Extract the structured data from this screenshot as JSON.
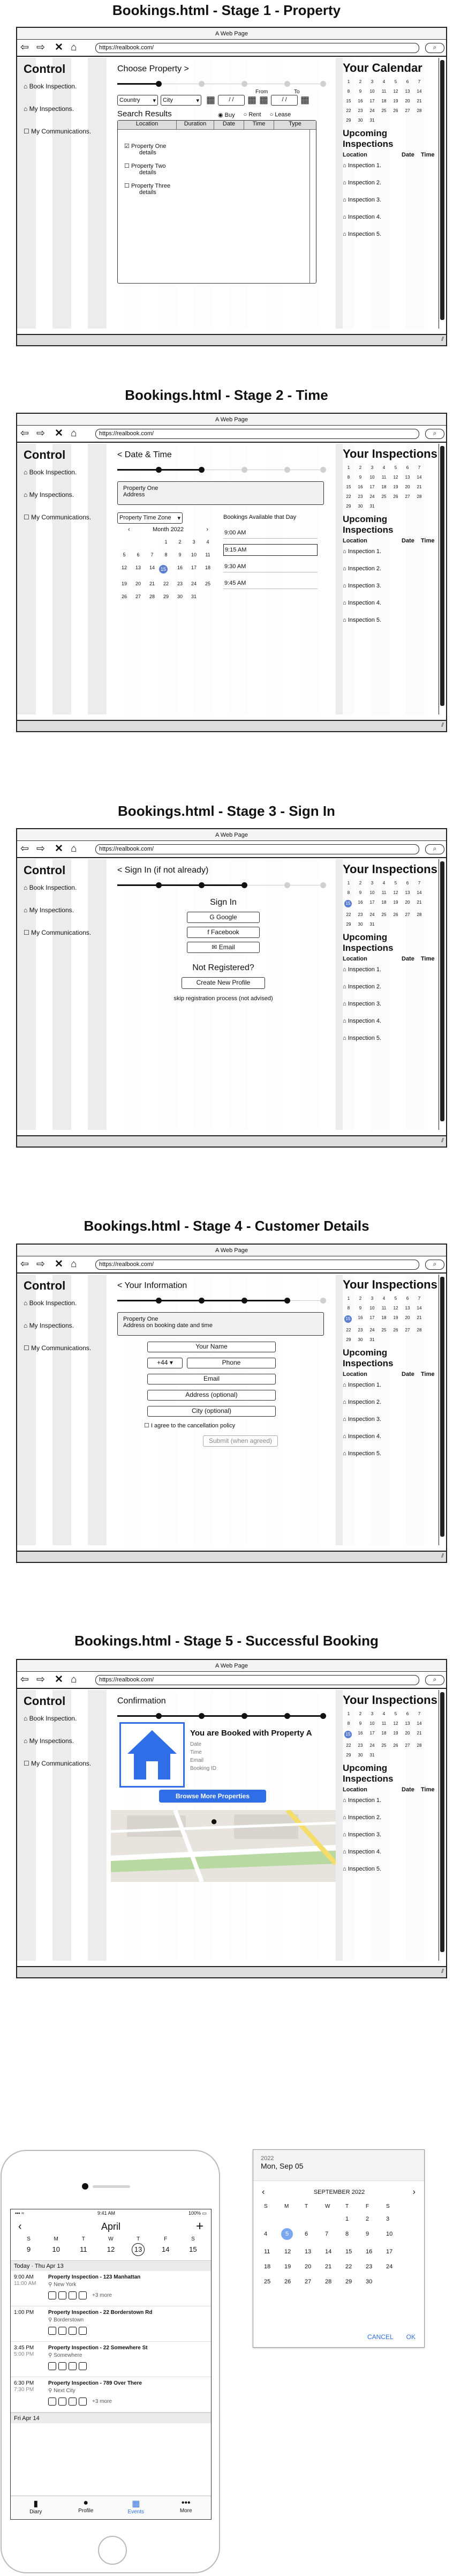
{
  "browser": {
    "window_title": "A Web Page",
    "url": "https://realbook.com/"
  },
  "left_nav": {
    "heading": "Control",
    "items": [
      "Book Inspection.",
      "My Inspections.",
      "My Communications."
    ]
  },
  "calendar": {
    "headers": [
      "1",
      "2",
      "3",
      "4",
      "5",
      "6",
      "7",
      "8",
      "9",
      "10",
      "11",
      "12",
      "13",
      "14",
      "15",
      "16",
      "17",
      "18",
      "19",
      "20",
      "21",
      "22",
      "23",
      "24",
      "25",
      "26",
      "27",
      "28",
      "29",
      "30",
      "31"
    ],
    "selected_day": "15"
  },
  "upcoming": {
    "heading": "Upcoming Inspections",
    "columns": [
      "Location",
      "Date",
      "Time"
    ],
    "rows": [
      "Inspection 1.",
      "Inspection 2.",
      "Inspection 3.",
      "Inspection 4.",
      "Inspection 5."
    ]
  },
  "stage1": {
    "title": "Bookings.html - Stage 1 - Property",
    "right_heading": "Your Calendar",
    "center_heading": "Choose Property >",
    "country": "Country",
    "city": "City",
    "from_label": "From",
    "to_label": "To",
    "date_placeholder": "/ /",
    "search_results": "Search Results",
    "radio_buy": "Buy",
    "radio_rent": "Rent",
    "radio_lease": "Lease",
    "table_columns": [
      "Location",
      "Duration",
      "Date",
      "Time",
      "Type"
    ],
    "properties": [
      {
        "name": "Property One",
        "details": "details",
        "checked": true
      },
      {
        "name": "Property Two",
        "details": "details",
        "checked": false
      },
      {
        "name": "Property Three",
        "details": "details",
        "checked": false
      }
    ]
  },
  "stage2": {
    "title": "Bookings.html - Stage 2 - Time",
    "right_heading": "Your Inspections",
    "center_heading": "< Date & Time",
    "property_line1": "Property One",
    "property_line2": "Address",
    "timezone": "Property Time Zone",
    "month": "Month 2022",
    "available_heading": "Bookings Available that Day",
    "times": [
      "9:00 AM",
      "9:15 AM",
      "9:30 AM",
      "9:45 AM"
    ],
    "selected_time_index": 1,
    "month_days": [
      "",
      "",
      "",
      "1",
      "2",
      "3",
      "4",
      "5",
      "6",
      "7",
      "8",
      "9",
      "10",
      "11",
      "12",
      "13",
      "14",
      "15",
      "16",
      "17",
      "18",
      "19",
      "20",
      "21",
      "22",
      "23",
      "24",
      "25",
      "26",
      "27",
      "28",
      "29",
      "30",
      "31"
    ],
    "selected_day": "15"
  },
  "stage3": {
    "title": "Bookings.html - Stage 3 - Sign In",
    "right_heading": "Your Inspections",
    "center_heading": "< Sign In (if not already)",
    "sign_in": "Sign In",
    "google": "Google",
    "facebook": "Facebook",
    "email": "Email",
    "not_registered": "Not Registered?",
    "create_profile": "Create New Profile",
    "skip": "skip registration process (not advised)"
  },
  "stage4": {
    "title": "Bookings.html - Stage 4 - Customer Details",
    "right_heading": "Your Inspections",
    "center_heading": "< Your Information",
    "property_line1": "Property One",
    "property_line2": "Address on booking date and time",
    "name": "Your Name",
    "code": "+44",
    "phone": "Phone",
    "email": "Email",
    "address": "Address (optional)",
    "city": "City (optional)",
    "agree": "I agree to the cancellation policy",
    "submit": "Submit (when agreed)"
  },
  "stage5": {
    "title": "Bookings.html - Stage 5 - Successful Booking",
    "right_heading": "Your Inspections",
    "center_heading": "Confirmation",
    "booked": "You are Booked with Property A",
    "details": [
      "Date",
      "Time",
      "Email",
      "Booking ID"
    ],
    "browse": "Browse More Properties"
  },
  "phone": {
    "time": "9:41 AM",
    "battery": "100%",
    "month": "April",
    "weekdays": [
      "S",
      "M",
      "T",
      "W",
      "T",
      "F",
      "S"
    ],
    "week": [
      "9",
      "10",
      "11",
      "12",
      "13",
      "14",
      "15"
    ],
    "today_label": "Today · Thu Apr 13",
    "events": [
      {
        "start": "9:00 AM",
        "end": "11:00 AM",
        "title": "Property Inspection - 123 Manhattan",
        "place": "New York",
        "more": "+3 more"
      },
      {
        "start": "1:00 PM",
        "end": "",
        "title": "Property Inspection - 22 Borderstown Rd",
        "place": "Borderstown",
        "more": ""
      },
      {
        "start": "3:45 PM",
        "end": "5:00 PM",
        "title": "Property Inspection - 22 Somewhere St",
        "place": "Somewhere",
        "more": ""
      },
      {
        "start": "6:30 PM",
        "end": "7:30 PM",
        "title": "Property Inspection - 789 Over There",
        "place": "Next City",
        "more": "+3 more"
      }
    ],
    "next_label": "Fri Apr 14",
    "tabs": [
      "Diary",
      "Profile",
      "Events",
      "More"
    ]
  },
  "date_dialog": {
    "year": "2022",
    "date": "Mon, Sep 05",
    "month": "SEPTEMBER 2022",
    "weekdays": [
      "S",
      "M",
      "T",
      "W",
      "T",
      "F",
      "S"
    ],
    "days": [
      "",
      "",
      "",
      "",
      "1",
      "2",
      "3",
      "4",
      "5",
      "6",
      "7",
      "8",
      "9",
      "10",
      "11",
      "12",
      "13",
      "14",
      "15",
      "16",
      "17",
      "18",
      "19",
      "20",
      "21",
      "22",
      "23",
      "24",
      "25",
      "26",
      "27",
      "28",
      "29",
      "30"
    ],
    "selected": "5",
    "cancel": "CANCEL",
    "ok": "OK"
  },
  "colors": {
    "accent": "#2f6ee6",
    "selected": "#5b7fd1",
    "map_road": "#f4dd6a",
    "map_green": "#b9d9a3"
  }
}
